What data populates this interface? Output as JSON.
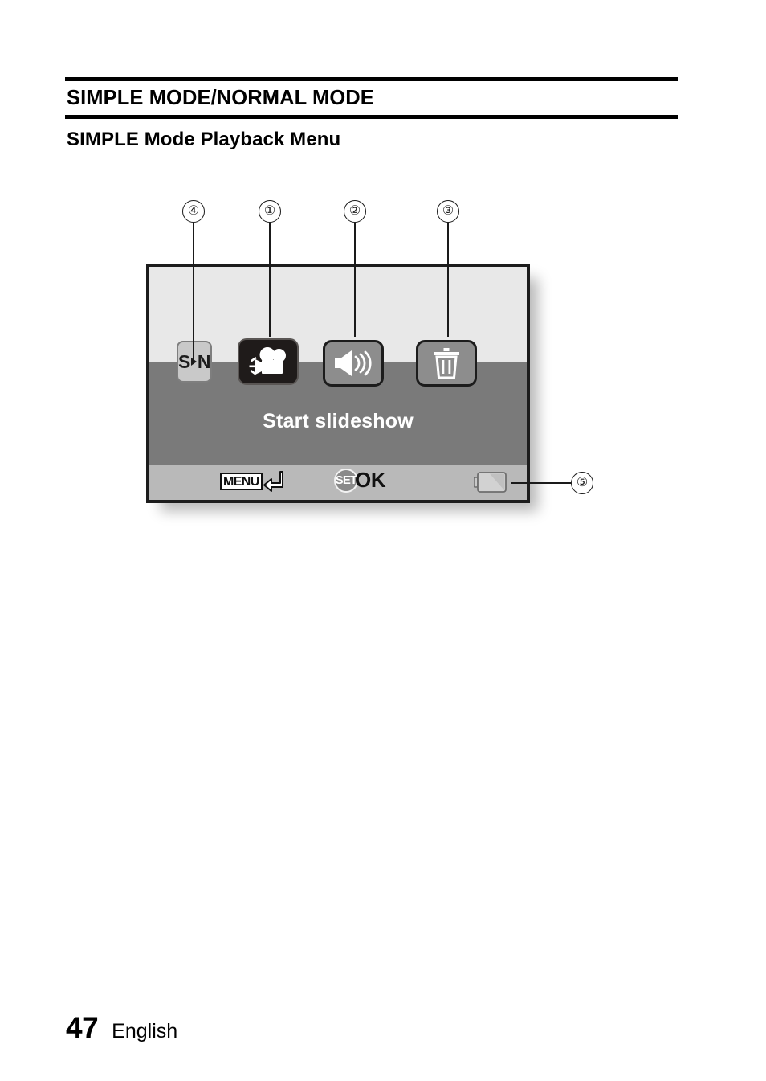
{
  "document": {
    "section_title": "SIMPLE MODE/NORMAL MODE",
    "subsection_title": "SIMPLE Mode Playback Menu",
    "page_number": "47",
    "language": "English"
  },
  "figure": {
    "callouts": [
      {
        "id": "callout-4",
        "label": "④",
        "number": "4",
        "target": "mode-switch-badge"
      },
      {
        "id": "callout-1",
        "label": "①",
        "number": "1",
        "target": "slideshow-tile"
      },
      {
        "id": "callout-2",
        "label": "②",
        "number": "2",
        "target": "volume-tile"
      },
      {
        "id": "callout-3",
        "label": "③",
        "number": "3",
        "target": "delete-tile"
      },
      {
        "id": "callout-5",
        "label": "⑤",
        "number": "5",
        "target": "battery-icon"
      }
    ]
  },
  "lcd": {
    "mode_badge": {
      "from": "S",
      "arrow": "▸",
      "to": "N",
      "name": "simple-to-normal-mode-switch"
    },
    "tiles": [
      {
        "name": "slideshow-tile",
        "icon": "movie-camera-icon",
        "state": "selected"
      },
      {
        "name": "volume-tile",
        "icon": "speaker-volume-icon",
        "state": "normal"
      },
      {
        "name": "delete-tile",
        "icon": "trash-delete-icon",
        "state": "normal"
      }
    ],
    "caption": "Start slideshow",
    "footer_bar": {
      "menu_label": "MENU",
      "menu_icon": "return-arrow-icon",
      "set_label": "SET",
      "ok_label": "OK",
      "battery_icon": "battery-level-icon"
    },
    "colors": {
      "upper_band": "#e8e8e8",
      "mid_band": "#7a7a7a",
      "bottom_bar": "#b9b9b9",
      "selected_tile": "#1f1b1a",
      "normal_tile": "#8d8d8d",
      "border": "#1c1c1c"
    }
  }
}
